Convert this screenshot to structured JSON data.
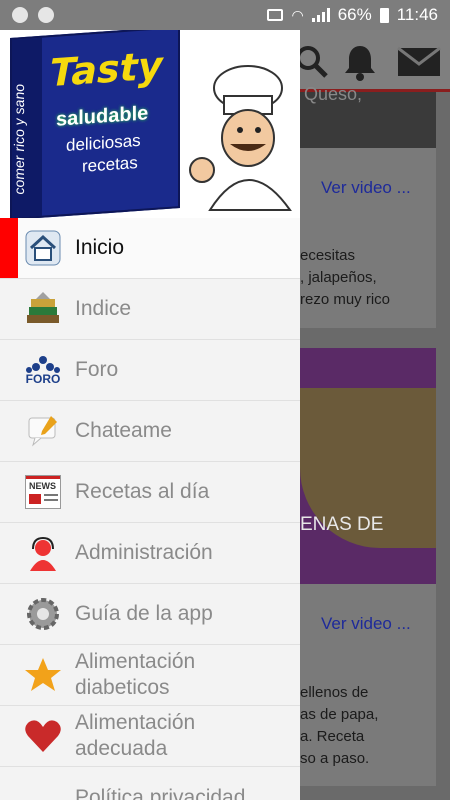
{
  "status": {
    "battery": "66%",
    "time": "11:46"
  },
  "drawer": {
    "header": {
      "book_title": "Tasty",
      "book_subtitle": "saludable",
      "book_line1": "deliciosas",
      "book_line2": "recetas",
      "spine_text": "comer rico y sano"
    },
    "items": [
      {
        "label": "Inicio",
        "icon": "home-icon",
        "active": true
      },
      {
        "label": "Indice",
        "icon": "books-icon"
      },
      {
        "label": "Foro",
        "icon": "forum-icon",
        "icon_text": "FORO"
      },
      {
        "label": "Chateame",
        "icon": "chat-icon"
      },
      {
        "label": "Recetas al día",
        "icon": "news-icon",
        "icon_text": "NEWS"
      },
      {
        "label": "Administración",
        "icon": "support-icon"
      },
      {
        "label": "Guía de la app",
        "icon": "gear-icon"
      },
      {
        "label": "Alimentación diabeticos",
        "icon": "star-icon"
      },
      {
        "label": "Alimentación adecuada",
        "icon": "heart-icon"
      },
      {
        "label": "Política privacidad",
        "icon": ""
      }
    ]
  },
  "background": {
    "card1_title_fragment": "Queso,",
    "card1_link": "Ver video ...",
    "card1_text": [
      "ecesitas",
      ", jalapeños,",
      "rezo muy rico"
    ],
    "card2_title_fragment": "ENAS DE",
    "card2_link": "Ver video ...",
    "card2_text": [
      "ellenos de",
      "as de papa,",
      "a. Receta",
      "so a paso."
    ]
  },
  "colors": {
    "accent": "#ff0000",
    "link": "#1e2a9a"
  }
}
